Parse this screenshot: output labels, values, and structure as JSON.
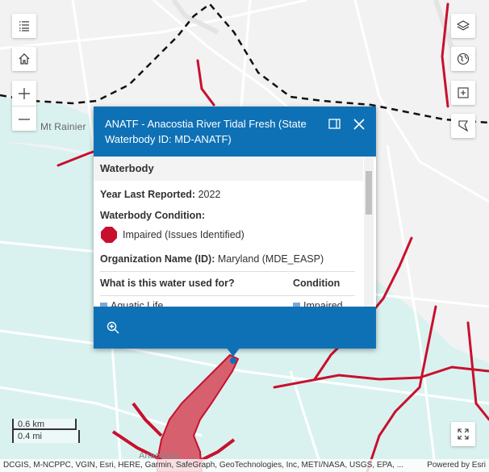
{
  "map": {
    "place_label": "Mt Rainier",
    "water_label": "Anacostia",
    "colors": {
      "water": "#d9f2f0",
      "land": "#f2f2f2",
      "road": "#ffffff",
      "waterbody_impaired": "#c8102e",
      "boundary": "#000000"
    }
  },
  "controls": {
    "left": [
      "list-icon",
      "home-icon",
      "zoom-in-icon",
      "zoom-out-icon"
    ],
    "right": [
      "layers-icon",
      "basemap-globe-icon",
      "expand-add-icon",
      "bookmark-icon",
      "fullscreen-icon"
    ]
  },
  "popup": {
    "title": "ANATF - Anacostia River Tidal Fresh (State Waterbody ID: MD-ANATF)",
    "section_title": "Waterbody",
    "year_label": "Year Last Reported:",
    "year_value": "2022",
    "condition_label": "Waterbody Condition:",
    "condition_value": "Impaired (Issues Identified)",
    "org_label": "Organization Name (ID):",
    "org_value": "Maryland (MDE_EASP)",
    "use_header": "What is this water used for?",
    "condition_header": "Condition",
    "use_row": "Aquatic Life",
    "use_row_condition": "Impaired"
  },
  "scale": {
    "km": "0.6 km",
    "mi": "0.4 mi"
  },
  "attribution": {
    "sources": "DCGIS, M-NCPPC, VGIN, Esri, HERE, Garmin, SafeGraph, GeoTechnologies, Inc, METI/NASA, USGS, EPA, ...",
    "powered": "Powered by Esri"
  }
}
